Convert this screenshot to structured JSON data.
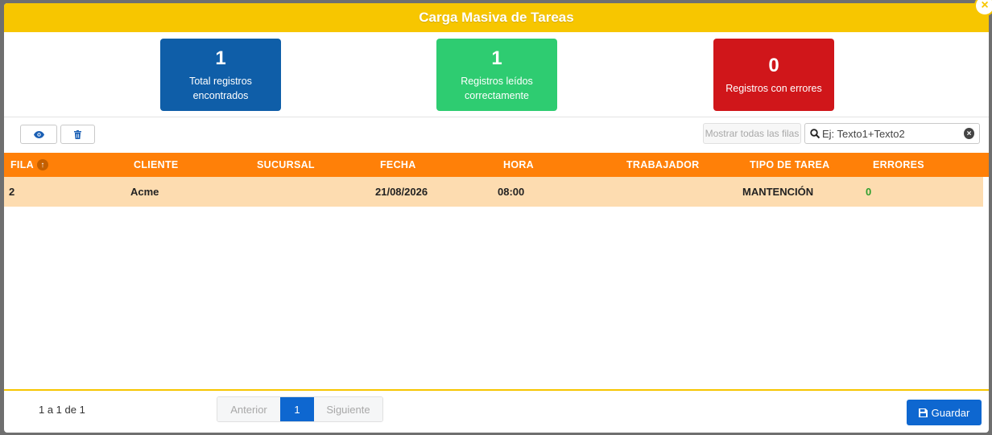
{
  "modal": {
    "title": "Carga Masiva de Tareas",
    "close_icon": "×"
  },
  "stats": [
    {
      "value": "1",
      "label_line1": "Total registros",
      "label_line2": "encontrados",
      "color": "#0f5ea8"
    },
    {
      "value": "1",
      "label_line1": "Registros leídos",
      "label_line2": "correctamente",
      "color": "#2ecc71"
    },
    {
      "value": "0",
      "label_line1": "Registros con errores",
      "label_line2": "",
      "color": "#d0161a"
    }
  ],
  "toolbar": {
    "view_icon": "eye-icon",
    "delete_icon": "trash-icon",
    "show_all_label": "Mostrar todas las filas",
    "search_placeholder": "Ej: Texto1+Texto2",
    "search_value": ""
  },
  "table": {
    "header_color": "#ff8008",
    "columns": [
      "FILA",
      "CLIENTE",
      "SUCURSAL",
      "FECHA",
      "HORA",
      "TRABAJADOR",
      "TIPO DE TAREA",
      "ERRORES"
    ],
    "rows": [
      {
        "fila": "2",
        "cliente": "Acme",
        "sucursal": "",
        "fecha": "21/08/2026",
        "hora": "08:00",
        "trabajador": "",
        "tipo_tarea": "MANTENCIÓN",
        "errores": "0"
      }
    ]
  },
  "footer": {
    "range_text": "1 a 1 de 1",
    "prev_label": "Anterior",
    "current_page": "1",
    "next_label": "Siguiente",
    "save_label": "Guardar"
  }
}
